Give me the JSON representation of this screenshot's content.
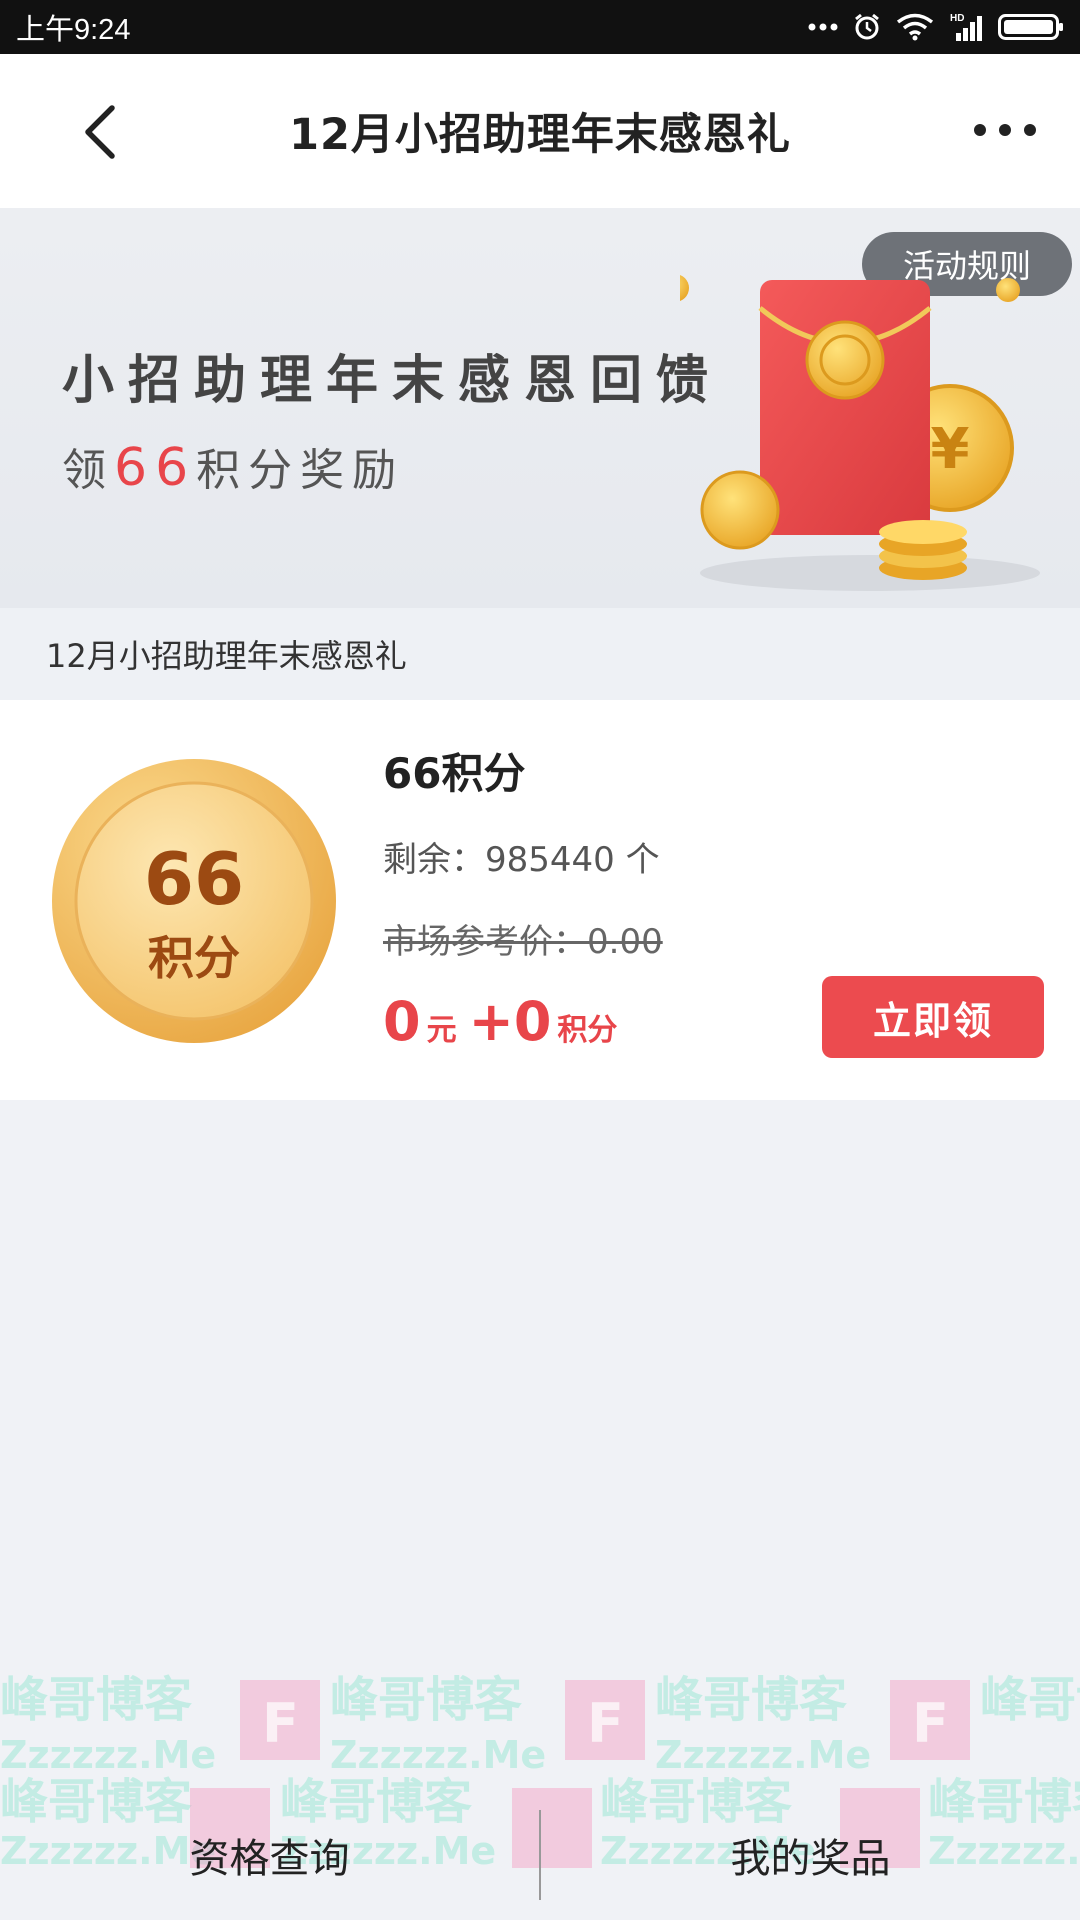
{
  "status_bar": {
    "time": "上午9:24",
    "icons": [
      "more-dots-icon",
      "alarm-icon",
      "wifi-icon",
      "hd-signal-icon",
      "battery-icon"
    ],
    "hd_label": "HD"
  },
  "nav": {
    "title": "12月小招助理年末感恩礼",
    "back_icon": "back-chevron-icon",
    "more_icon": "more-dots-icon"
  },
  "banner": {
    "rules_label": "活动规则",
    "headline": "小招助理年末感恩回馈",
    "sub_prefix": "领",
    "sub_number": "66",
    "sub_suffix": "积分奖励",
    "art": "red-envelope-with-coins-illustration",
    "envelope_symbol": "¥"
  },
  "section": {
    "label": "12月小招助理年末感恩礼"
  },
  "reward": {
    "coin_number": "66",
    "coin_label": "积分",
    "name": "66积分",
    "remaining": "剩余：985440 个",
    "market_price": "市场参考价：0.00",
    "price_cash": "0",
    "price_cash_unit": "元",
    "price_plus": "+",
    "price_points": "0",
    "price_points_unit": "积分",
    "claim_label": "立即领"
  },
  "bottom_bar": {
    "left_tab": "资格查询",
    "right_tab": "我的奖品"
  },
  "watermark": {
    "brand": "峰哥博客",
    "domain": "Zzzzzz.Me",
    "logo_letter": "F"
  },
  "colors": {
    "accent_red": "#ec4b4f",
    "coin_gold": "#f2b84b",
    "page_bg": "#f0f2f6"
  }
}
